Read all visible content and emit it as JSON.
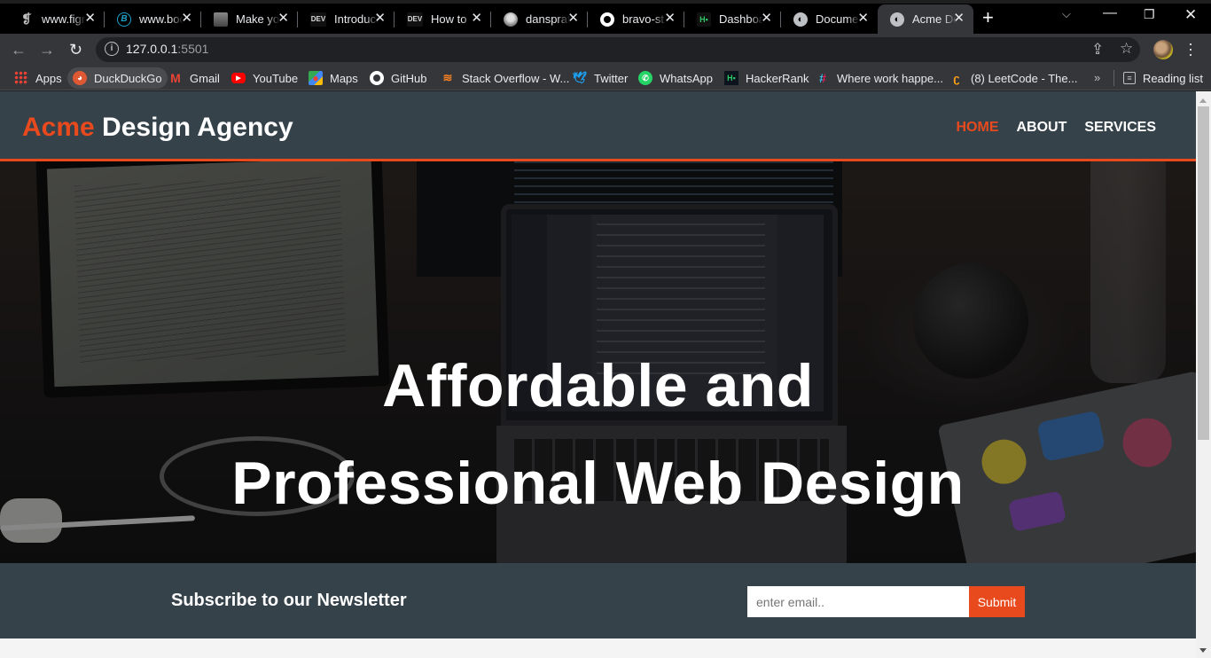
{
  "browser": {
    "tabs": [
      {
        "title": "www.figma.com",
        "icon": "figma-icon",
        "active": false
      },
      {
        "title": "www.bootstrap",
        "icon": "bootstrap-icon",
        "active": false
      },
      {
        "title": "Make your",
        "icon": "profile-photo-icon",
        "active": false
      },
      {
        "title": "Introducing",
        "icon": "dev-icon",
        "active": false
      },
      {
        "title": "How to",
        "icon": "dev-icon",
        "active": false
      },
      {
        "title": "dansprat",
        "icon": "profile-photo-icon",
        "active": false
      },
      {
        "title": "bravo-st",
        "icon": "github-icon",
        "active": false
      },
      {
        "title": "Dashboard",
        "icon": "hackerrank-icon",
        "active": false
      },
      {
        "title": "Document",
        "icon": "globe-icon",
        "active": false
      },
      {
        "title": "Acme Design",
        "icon": "globe-icon",
        "active": true
      }
    ],
    "address": {
      "host": "127.0.0.1",
      "port": ":5501"
    },
    "bookmarks": [
      {
        "label": "Apps",
        "icon": "apps-grid-icon"
      },
      {
        "label": "DuckDuckGo",
        "icon": "duckduckgo-icon"
      },
      {
        "label": "Gmail",
        "icon": "gmail-icon"
      },
      {
        "label": "YouTube",
        "icon": "youtube-icon"
      },
      {
        "label": "Maps",
        "icon": "maps-icon"
      },
      {
        "label": "GitHub",
        "icon": "github-icon"
      },
      {
        "label": "Stack Overflow - W...",
        "icon": "stackoverflow-icon"
      },
      {
        "label": "Twitter",
        "icon": "twitter-icon"
      },
      {
        "label": "WhatsApp",
        "icon": "whatsapp-icon"
      },
      {
        "label": "HackerRank",
        "icon": "hackerrank-icon"
      },
      {
        "label": "Where work happe...",
        "icon": "slack-icon"
      },
      {
        "label": "(8) LeetCode - The...",
        "icon": "leetcode-icon"
      }
    ],
    "bookmarks_overflow": "»",
    "reading_list": "Reading list"
  },
  "site": {
    "brand": {
      "highlight": "Acme",
      "rest": " Design Agency"
    },
    "nav": [
      {
        "label": "Home",
        "current": true
      },
      {
        "label": "About",
        "current": false
      },
      {
        "label": "Services",
        "current": false
      }
    ],
    "hero": {
      "line1": "Affordable and",
      "line2": "Professional Web Design"
    },
    "newsletter": {
      "title": "Subscribe to our Newsletter",
      "email_placeholder": "enter email..",
      "email_value": "",
      "submit_label": "Submit"
    },
    "colors": {
      "accent": "#e8491d",
      "header_bg": "#35424a",
      "body_bg": "#f4f4f4"
    }
  }
}
